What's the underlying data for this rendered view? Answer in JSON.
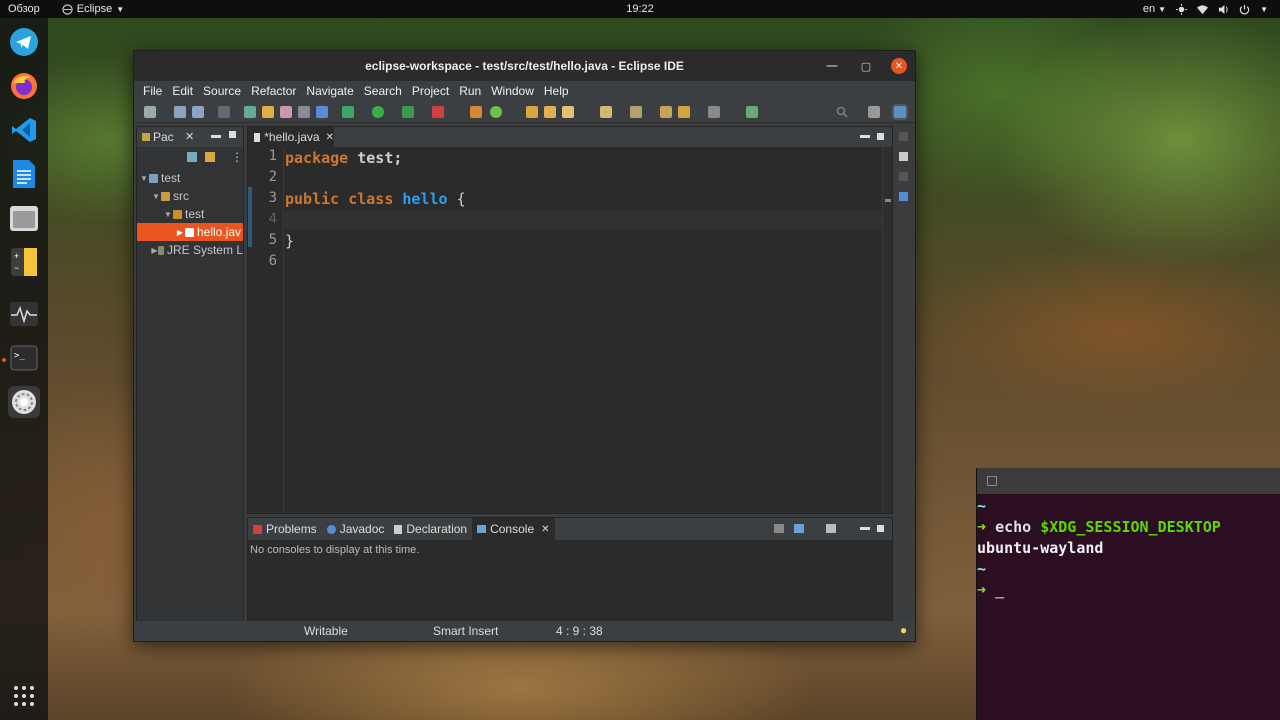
{
  "topbar": {
    "overview": "Обзор",
    "app_name": "Eclipse",
    "clock": "19:22",
    "lang": "en"
  },
  "dock": {
    "items": [
      "telegram",
      "firefox",
      "vscode",
      "writer",
      "files",
      "calculator",
      "system-monitor",
      "terminal",
      "settings"
    ]
  },
  "eclipse": {
    "title": "eclipse-workspace - test/src/test/hello.java - Eclipse IDE",
    "menu": [
      "File",
      "Edit",
      "Source",
      "Refactor",
      "Navigate",
      "Search",
      "Project",
      "Run",
      "Window",
      "Help"
    ],
    "package_explorer": {
      "tab_label": "Pac",
      "tree": [
        {
          "label": "test",
          "level": 0
        },
        {
          "label": "src",
          "level": 1
        },
        {
          "label": "test",
          "level": 2
        },
        {
          "label": "hello.jav",
          "level": 3,
          "selected": true
        },
        {
          "label": "JRE System L",
          "level": 1
        }
      ]
    },
    "editor": {
      "tab_label": "*hello.java",
      "line_numbers": [
        "1",
        "2",
        "3",
        "4",
        "5",
        "6"
      ],
      "code": {
        "l1_kw": "package",
        "l1_name": "test;",
        "l3_kw1": "public",
        "l3_kw2": "class",
        "l3_name": "hello",
        "l3_brace": "{",
        "l5_brace": "}"
      }
    },
    "bottom_panel": {
      "tabs": [
        "Problems",
        "Javadoc",
        "Declaration",
        "Console"
      ],
      "active_tab": "Console",
      "message": "No consoles to display at this time."
    },
    "status": {
      "writable": "Writable",
      "insert_mode": "Smart Insert",
      "position": "4 : 9 : 38"
    }
  },
  "terminal": {
    "line1": "~",
    "prompt": "➜",
    "command": "echo",
    "variable": "$XDG_SESSION_DESKTOP",
    "output": "ubuntu-wayland",
    "line4": "~",
    "cursor": "_"
  },
  "colors": {
    "accent": "#e95420",
    "keyword": "#cc7832",
    "class_name": "#2aa1f0",
    "terminal_bg": "#2c0e22"
  }
}
